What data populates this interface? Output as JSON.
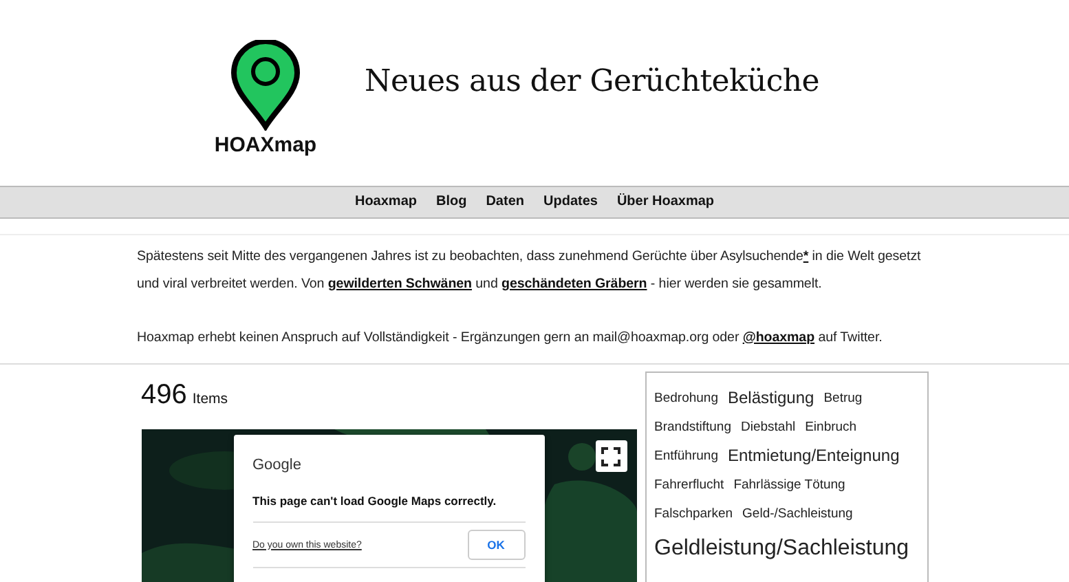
{
  "header": {
    "logo_text": "HOAXmap",
    "title": "Neues aus der Gerüchteküche"
  },
  "nav": [
    {
      "label": "Hoaxmap"
    },
    {
      "label": "Blog"
    },
    {
      "label": "Daten"
    },
    {
      "label": "Updates"
    },
    {
      "label": "Über Hoaxmap"
    }
  ],
  "intro": [
    [
      {
        "text": "Spätestens seit Mitte des vergangenen Jahres ist zu beobachten, dass zunehmend Gerüchte über Asylsuchende",
        "kind": "text"
      },
      {
        "text": "*",
        "kind": "link"
      },
      {
        "text": " in die Welt gesetzt und viral verbreitet werden. Von ",
        "kind": "text"
      },
      {
        "text": "gewilderten Schwänen",
        "kind": "link"
      },
      {
        "text": " und ",
        "kind": "text"
      },
      {
        "text": "geschändeten Gräbern",
        "kind": "link"
      },
      {
        "text": " - hier werden sie gesammelt.",
        "kind": "text"
      }
    ],
    [
      {
        "text": "Hoaxmap erhebt keinen Anspruch auf Vollständigkeit - Ergänzungen gern an mail@hoaxmap.org oder ",
        "kind": "text"
      },
      {
        "text": "@hoaxmap",
        "kind": "link"
      },
      {
        "text": " auf Twitter.",
        "kind": "text"
      }
    ]
  ],
  "count": {
    "number": "496",
    "unit": "Items"
  },
  "map": {
    "kind": "picture",
    "dialog": {
      "brand": "Google",
      "message": "This page can't load Google Maps correctly.",
      "link": "Do you own this website?",
      "button": "OK"
    }
  },
  "tags": [
    {
      "label": "Bedrohung",
      "kind": "small"
    },
    {
      "label": "Belästigung",
      "kind": "medium"
    },
    {
      "label": "Betrug",
      "kind": "small"
    },
    {
      "label": "Brandstiftung",
      "kind": "small"
    },
    {
      "label": "Diebstahl",
      "kind": "small"
    },
    {
      "label": "Einbruch",
      "kind": "small"
    },
    {
      "label": "Entführung",
      "kind": "small"
    },
    {
      "label": "Entmietung/Enteignung",
      "kind": "medium"
    },
    {
      "label": "Fahrerflucht",
      "kind": "small"
    },
    {
      "label": "Fahrlässige Tötung",
      "kind": "small"
    },
    {
      "label": "Falschparken",
      "kind": "small"
    },
    {
      "label": "Geld-/Sachleistung",
      "kind": "small"
    },
    {
      "label": "Geldleistung/Sachleistung",
      "kind": "large"
    }
  ]
}
